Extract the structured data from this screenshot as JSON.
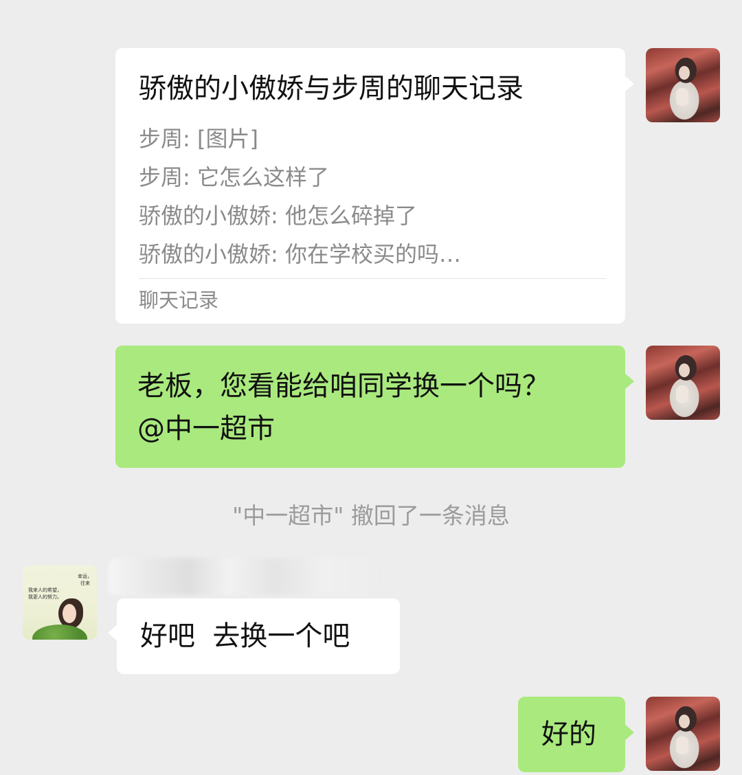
{
  "chat_history_card": {
    "title": "骄傲的小傲娇与步周的聊天记录",
    "lines": [
      "步周: [图片]",
      "步周: 它怎么这样了",
      "骄傲的小傲娇: 他怎么碎掉了",
      "骄傲的小傲娇: 你在学校买的吗…"
    ],
    "footer": "聊天记录"
  },
  "messages": {
    "outgoing_1": "老板，您看能给咱同学换一个吗？\n@中一超市",
    "system_notice": "\"中一超市\" 撤回了一条消息",
    "incoming_1": "好吧  去换一个吧",
    "outgoing_2": "好的"
  },
  "avatars": {
    "self": "self-avatar-portrait",
    "other_text": [
      "幸运，",
      "往来",
      "我来人的希望，",
      "我更人的努力。"
    ]
  },
  "colors": {
    "background": "#ededed",
    "outgoing_bubble": "#a9e97e",
    "incoming_bubble": "#ffffff",
    "muted_text": "#8a8a8a"
  }
}
